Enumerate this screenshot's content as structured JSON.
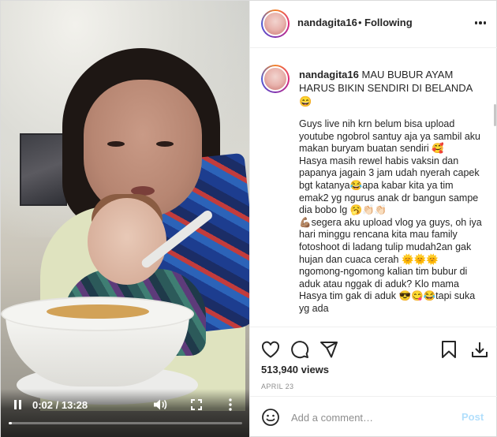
{
  "video": {
    "time": "0:02 / 13:28",
    "progress_fraction": 0.003
  },
  "post": {
    "username": "nandagita16",
    "follow_separator": "•",
    "follow_status": "Following",
    "caption_title": "MAU BUBUR AYAM HARUS BIKIN SENDIRI DI BELANDA 😄",
    "caption_body": "Guys live nih krn belum bisa upload youtube ngobrol santuy aja ya sambil aku makan buryam buatan sendiri 🥰\nHasya masih rewel habis vaksin dan papanya jagain 3 jam udah nyerah capek bgt katanya😂apa kabar kita ya tim emak2 yg ngurus anak dr bangun sampe dia bobo lg 🥱👏🏻👏🏻\n💪🏽segera aku upload vlog ya guys, oh iya hari minggu rencana kita mau family fotoshoot di ladang tulip mudah2an gak hujan dan cuaca cerah 🌞🌞🌞 ngomong-ngomong kalian tim bubur di aduk atau nggak di aduk? Klo mama Hasya tim gak di aduk 😎😋😂tapi suka yg ada",
    "views": "513,940 views",
    "date": "APRIL 23"
  },
  "comment_box": {
    "placeholder": "Add a comment…",
    "post_label": "Post"
  },
  "icons": {
    "heart": "heart-icon",
    "comment": "comment-icon",
    "share": "share-icon",
    "bookmark": "bookmark-icon",
    "download": "download-icon",
    "emoji": "emoji-icon",
    "more": "more-icon",
    "pause": "pause-icon",
    "volume": "volume-icon",
    "fullscreen": "fullscreen-icon"
  },
  "colors": {
    "post_button_disabled": "#b2dffc",
    "secondary_text": "#8e8e8e",
    "border": "#efefef"
  }
}
